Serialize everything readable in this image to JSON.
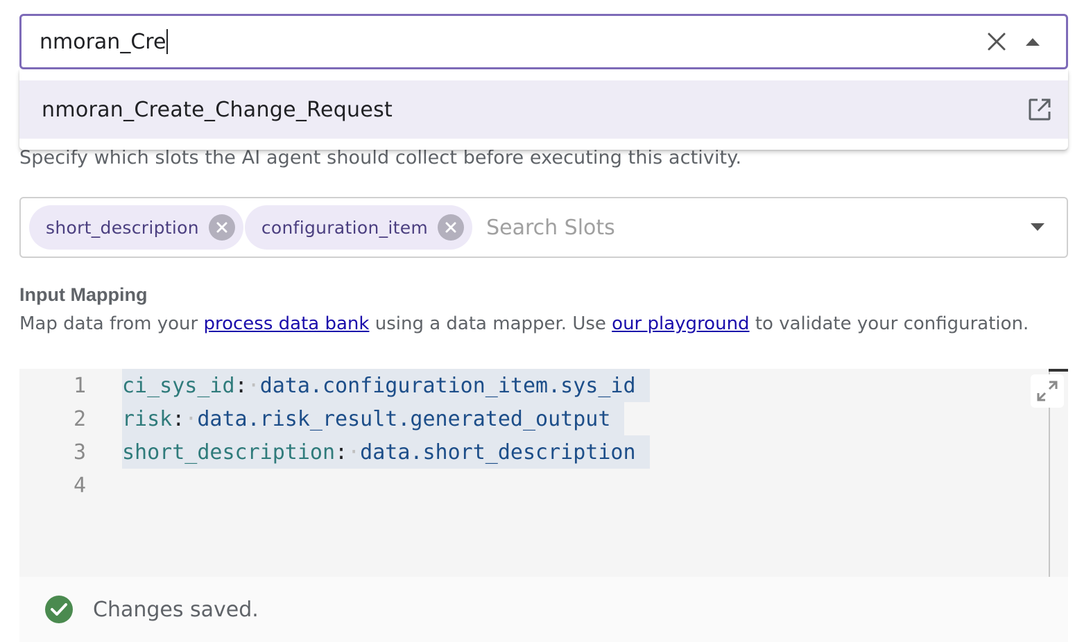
{
  "activity_select": {
    "input_value": "nmoran_Cre",
    "options": [
      {
        "label": "nmoran_Create_Change_Request"
      }
    ]
  },
  "slots": {
    "description": "Specify which slots the AI agent should collect before executing this activity.",
    "chips": [
      {
        "label": "short_description"
      },
      {
        "label": "configuration_item"
      }
    ],
    "search_placeholder": "Search Slots"
  },
  "input_mapping": {
    "title": "Input Mapping",
    "desc_before": "Map data from your ",
    "link_data_bank": "process data bank",
    "desc_middle": " using a data mapper. Use ",
    "link_playground": "our playground",
    "desc_after": " to validate your configuration."
  },
  "editor": {
    "lines": [
      {
        "number": "1",
        "key": "ci_sys_id",
        "value": "data.configuration_item.sys_id"
      },
      {
        "number": "2",
        "key": "risk",
        "value": "data.risk_result.generated_output"
      },
      {
        "number": "3",
        "key": "short_description",
        "value": "data.short_description"
      },
      {
        "number": "4",
        "key": "",
        "value": ""
      }
    ]
  },
  "toast": {
    "message": "Changes saved.",
    "status_color": "#4a8a4f"
  },
  "colors": {
    "focus_border": "#7e6bb8",
    "chip_bg": "#ede9f7",
    "option_highlight": "#eeecf6"
  }
}
